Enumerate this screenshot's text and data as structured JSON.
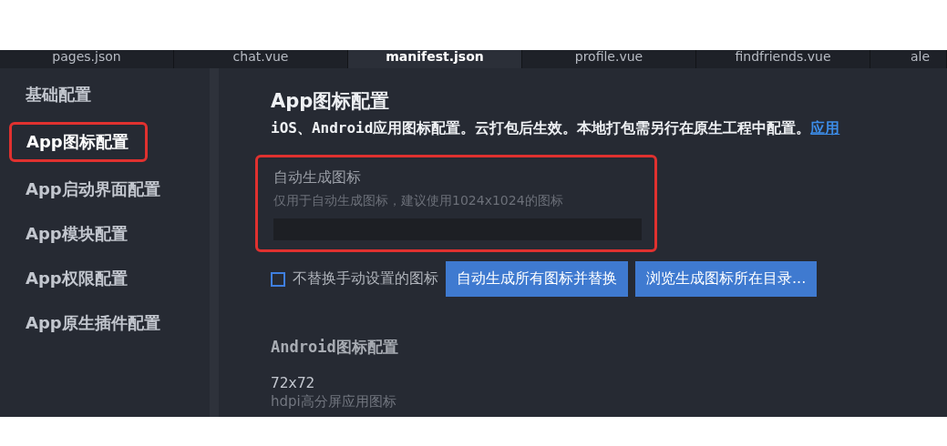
{
  "tabs": [
    {
      "label": "pages.json",
      "selected": false
    },
    {
      "label": "chat.vue",
      "selected": false
    },
    {
      "label": "manifest.json",
      "selected": true
    },
    {
      "label": "profile.vue",
      "selected": false
    },
    {
      "label": "findfriends.vue",
      "selected": false
    },
    {
      "label": "ale",
      "selected": false
    }
  ],
  "sidebar": {
    "items": [
      {
        "label": "基础配置",
        "selected": false,
        "highlighted": false
      },
      {
        "label": "App图标配置",
        "selected": true,
        "highlighted": true
      },
      {
        "label": "App启动界面配置",
        "selected": false,
        "highlighted": false
      },
      {
        "label": "App模块配置",
        "selected": false,
        "highlighted": false
      },
      {
        "label": "App权限配置",
        "selected": false,
        "highlighted": false
      },
      {
        "label": "App原生插件配置",
        "selected": false,
        "highlighted": false
      }
    ]
  },
  "content": {
    "title": "App图标配置",
    "description": "iOS、Android应用图标配置。云打包后生效。本地打包需另行在原生工程中配置。",
    "link": "应用",
    "auto_section": {
      "highlighted": true,
      "label": "自动生成图标",
      "hint": "仅用于自动生成图标，建议使用1024x1024的图标"
    },
    "checkbox": {
      "label": "不替换手动设置的图标",
      "checked": false
    },
    "buttons": [
      "自动生成所有图标并替换",
      "浏览生成图标所在目录..."
    ],
    "android": {
      "title": "Android图标配置",
      "size": "72x72",
      "note": "hdpi高分屏应用图标"
    }
  }
}
